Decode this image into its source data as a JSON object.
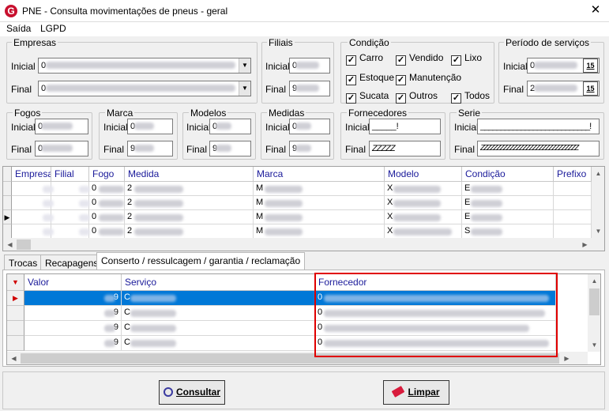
{
  "window": {
    "title": "PNE - Consulta movimentações de pneus - geral",
    "logo_letter": "G",
    "close": "✕"
  },
  "menu": [
    "Saída",
    "LGPD"
  ],
  "filters": {
    "empresas": {
      "label": "Empresas",
      "inicial_label": "Inicial",
      "inicial_value": "0",
      "final_label": "Final",
      "final_value": "0"
    },
    "filiais": {
      "label": "Filiais",
      "inicial_label": "Inicial",
      "inicial_value": "0",
      "final_label": "Final",
      "final_value": "9"
    },
    "condicao": {
      "label": "Condição",
      "options": [
        {
          "label": "Carro",
          "checked": true
        },
        {
          "label": "Vendido",
          "checked": true
        },
        {
          "label": "Lixo",
          "checked": true
        },
        {
          "label": "Estoque",
          "checked": true
        },
        {
          "label": "Manutenção",
          "checked": true
        },
        {
          "label": "Sucata",
          "checked": true
        },
        {
          "label": "Outros",
          "checked": true
        },
        {
          "label": "Todos",
          "checked": true
        }
      ]
    },
    "periodo": {
      "label": "Período de serviços",
      "inicial_label": "Inicial",
      "inicial_value": "0",
      "final_label": "Final",
      "final_value": "2",
      "calendar_icon": "15"
    },
    "fogos": {
      "label": "Fogos",
      "inicial_label": "Inicial",
      "inicial_value": "0",
      "final_label": "Final",
      "final_value": "0"
    },
    "marca": {
      "label": "Marca",
      "inicial_label": "Inicial",
      "inicial_value": "0",
      "final_label": "Final",
      "final_value": "9"
    },
    "modelos": {
      "label": "Modelos",
      "inicial_label": "Inicial",
      "inicial_value": "0",
      "final_label": "Final",
      "final_value": "9"
    },
    "medidas": {
      "label": "Medidas",
      "inicial_label": "Inicial",
      "inicial_value": "0",
      "final_label": "Final",
      "final_value": "9"
    },
    "fornecedores": {
      "label": "Fornecedores",
      "inicial_label": "Inicial",
      "inicial_value": "_____!",
      "final_label": "Final",
      "final_value": "ZZZZZ"
    },
    "serie": {
      "label": "Serie",
      "inicial_label": "Inicial",
      "inicial_value": "___________________________!",
      "final_label": "Final",
      "final_value": "ZZZZZZZZZZZZZZZZZZZZZZZZZZZZZZ"
    }
  },
  "main_grid": {
    "columns": [
      "Empresa",
      "Filial",
      "Fogo",
      "Medida",
      "Marca",
      "Modelo",
      "Condição",
      "Prefixo"
    ],
    "rows": [
      {
        "fogo": "0",
        "medida": "2",
        "marca": "M",
        "modelo": "X",
        "condicao": "E",
        "current": false
      },
      {
        "fogo": "0",
        "medida": "2",
        "marca": "M",
        "modelo": "X",
        "condicao": "E",
        "current": false
      },
      {
        "fogo": "0",
        "medida": "2",
        "marca": "M",
        "modelo": "X",
        "condicao": "E",
        "current": true
      },
      {
        "fogo": "0",
        "medida": "2",
        "marca": "M",
        "modelo": "X",
        "condicao": "S",
        "current": false
      }
    ]
  },
  "tabs": [
    "Trocas",
    "Recapagens",
    "Conserto / ressulcagem / garantia / reclamação"
  ],
  "detail_grid": {
    "columns": [
      "Valor",
      "Serviço",
      "Fornecedor"
    ],
    "rows": [
      {
        "valor": "9",
        "servico": "C",
        "fornecedor": "0",
        "selected": true
      },
      {
        "valor": "9",
        "servico": "C",
        "fornecedor": "0",
        "selected": false
      },
      {
        "valor": "9",
        "servico": "C",
        "fornecedor": "0",
        "selected": false
      },
      {
        "valor": "9",
        "servico": "C",
        "fornecedor": "0",
        "selected": false
      }
    ]
  },
  "buttons": {
    "consultar": "Consultar",
    "limpar": "Limpar"
  },
  "colors": {
    "highlight_box": "#e00000",
    "selected_row": "#0078d7",
    "header_text": "#1a1a9a",
    "logo": "#c8102e"
  }
}
